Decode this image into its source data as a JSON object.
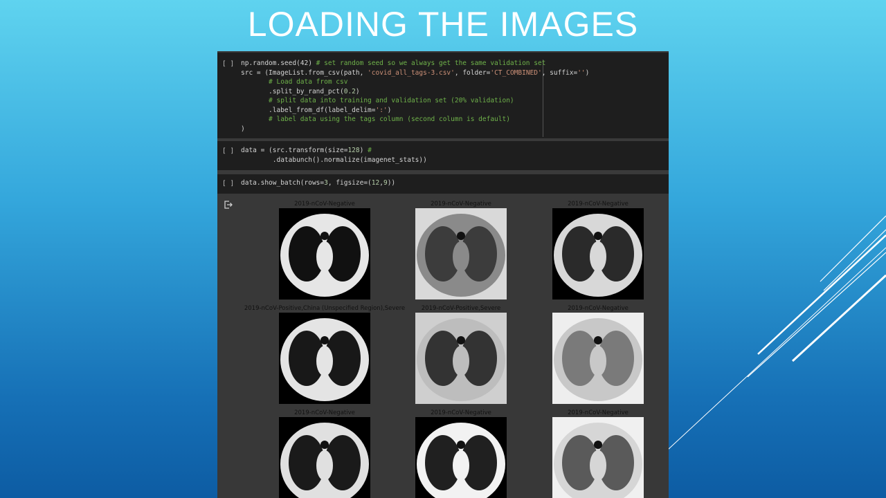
{
  "slide": {
    "title": "LOADING THE IMAGES"
  },
  "cells": [
    {
      "prompt": "[ ]",
      "lines": [
        [
          "np.random.seed(42) ",
          {
            "c": "cm",
            "t": "# set random seed so we always get the same validation set"
          }
        ],
        [
          "src = (ImageList.from_csv(path, ",
          {
            "c": "st",
            "t": "'covid_all_tags-3.csv'"
          },
          ", folder=",
          {
            "c": "st",
            "t": "'CT_COMBINED'"
          },
          ", suffix=",
          {
            "c": "st",
            "t": "''"
          },
          ")"
        ],
        [
          "       ",
          {
            "c": "cm",
            "t": "# Load data from csv"
          }
        ],
        [
          "       .split_by_rand_pct(",
          {
            "c": "nu",
            "t": "0.2"
          },
          ")"
        ],
        [
          "       ",
          {
            "c": "cm",
            "t": "# split data into training and validation set (20% validation)"
          }
        ],
        [
          "       .label_from_df(label_delim=",
          {
            "c": "st",
            "t": "':'"
          },
          ")"
        ],
        [
          "       ",
          {
            "c": "cm",
            "t": "# label data using the tags column (second column is default)"
          }
        ],
        [
          ")"
        ]
      ]
    },
    {
      "prompt": "[ ]",
      "lines": [
        [
          "data = (src.transform(size=",
          {
            "c": "nu",
            "t": "128"
          },
          ") ",
          {
            "c": "cm",
            "t": "#"
          }
        ],
        [
          "        .databunch().normalize(imagenet_stats))"
        ]
      ]
    },
    {
      "prompt": "[ ]",
      "lines": [
        [
          "data.show_batch(rows=",
          {
            "c": "nu",
            "t": "3"
          },
          ", figsize=(",
          {
            "c": "nu",
            "t": "12"
          },
          ",",
          {
            "c": "nu",
            "t": "9"
          },
          "))"
        ]
      ]
    }
  ],
  "output": {
    "icon": "output-redirect-icon",
    "labels": [
      "2019-nCoV-Negative",
      "2019-nCoV-Negative",
      "2019-nCoV-Negative",
      "2019-nCoV-Positive,China (Unspecified Region),Severe",
      "2019-nCoV-Positive,Severe",
      "2019-nCoV-Negative",
      "2019-nCoV-Negative",
      "2019-nCoV-Negative",
      "2019-nCoV-Negative"
    ]
  }
}
